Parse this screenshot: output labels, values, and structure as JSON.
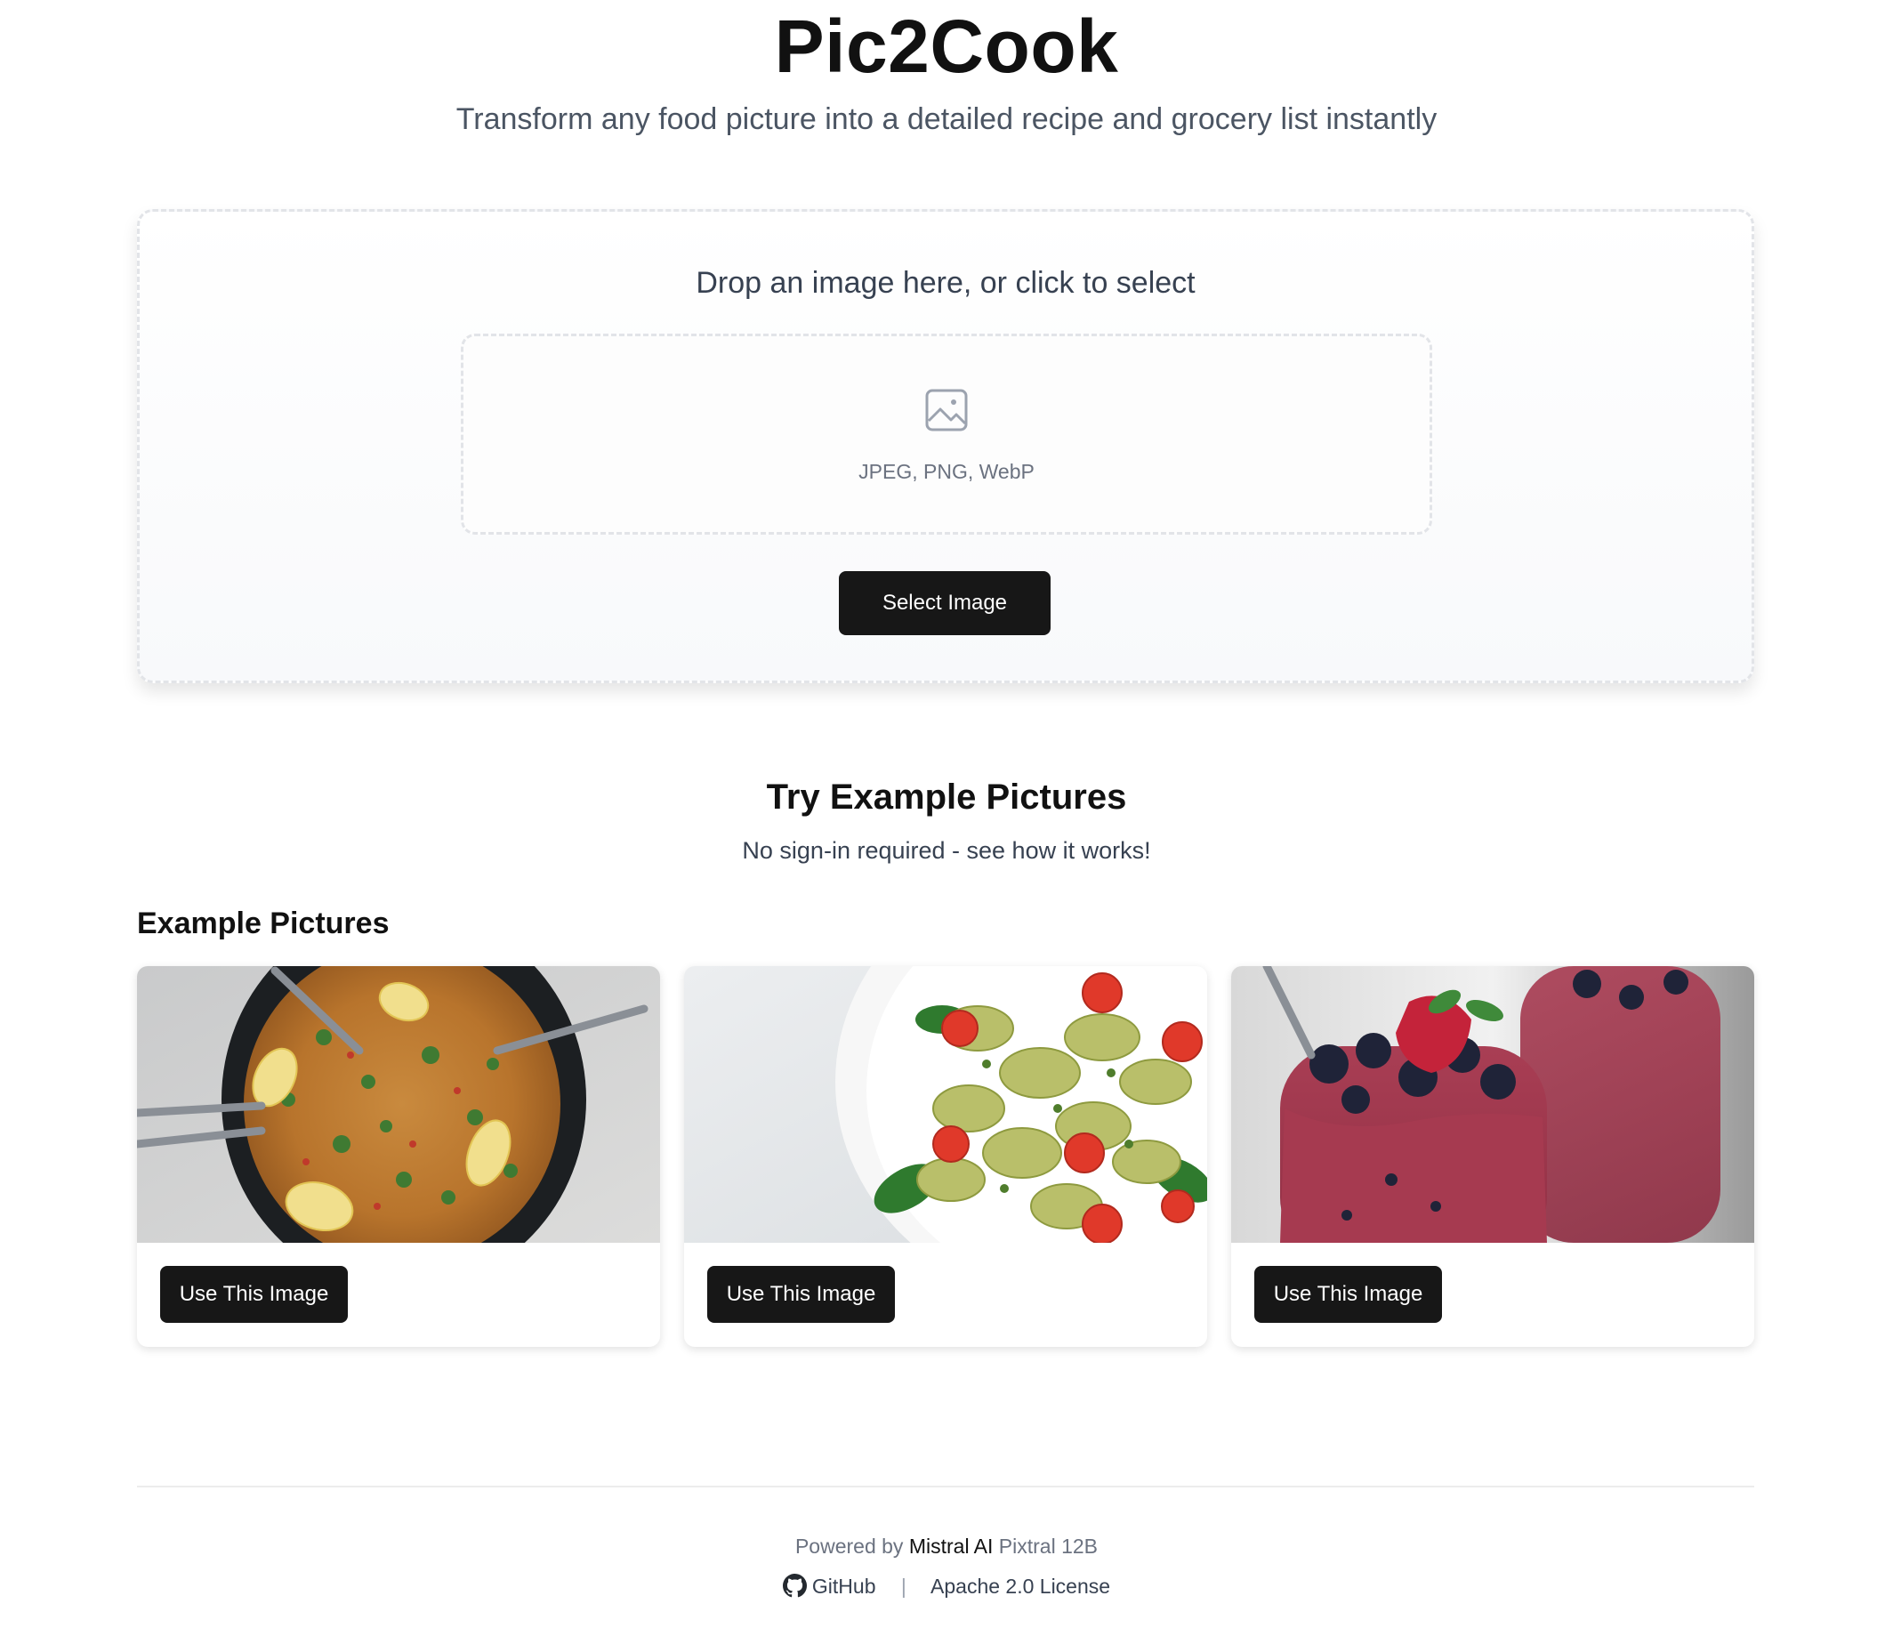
{
  "header": {
    "title": "Pic2Cook",
    "subtitle": "Transform any food picture into a detailed recipe and grocery list instantly"
  },
  "upload": {
    "heading": "Drop an image here, or click to select",
    "formats": "JPEG, PNG, WebP",
    "icon": "image-icon",
    "select_label": "Select Image"
  },
  "examples": {
    "title": "Try Example Pictures",
    "subtitle": "No sign-in required - see how it works!",
    "label": "Example Pictures",
    "cards": [
      {
        "image": "paella-photo",
        "button": "Use This Image"
      },
      {
        "image": "pesto-pasta-salad-photo",
        "button": "Use This Image"
      },
      {
        "image": "berry-smoothie-photo",
        "button": "Use This Image"
      }
    ]
  },
  "footer": {
    "powered_prefix": "Powered by",
    "powered_brand": "Mistral AI",
    "powered_model": "Pixtral 12B",
    "github_label": "GitHub",
    "github_icon": "github-icon",
    "separator": "|",
    "license_label": "Apache 2.0 License"
  },
  "colors": {
    "primary_button": "#171717",
    "text_muted": "#6b7280",
    "border": "#e2e4e8"
  }
}
